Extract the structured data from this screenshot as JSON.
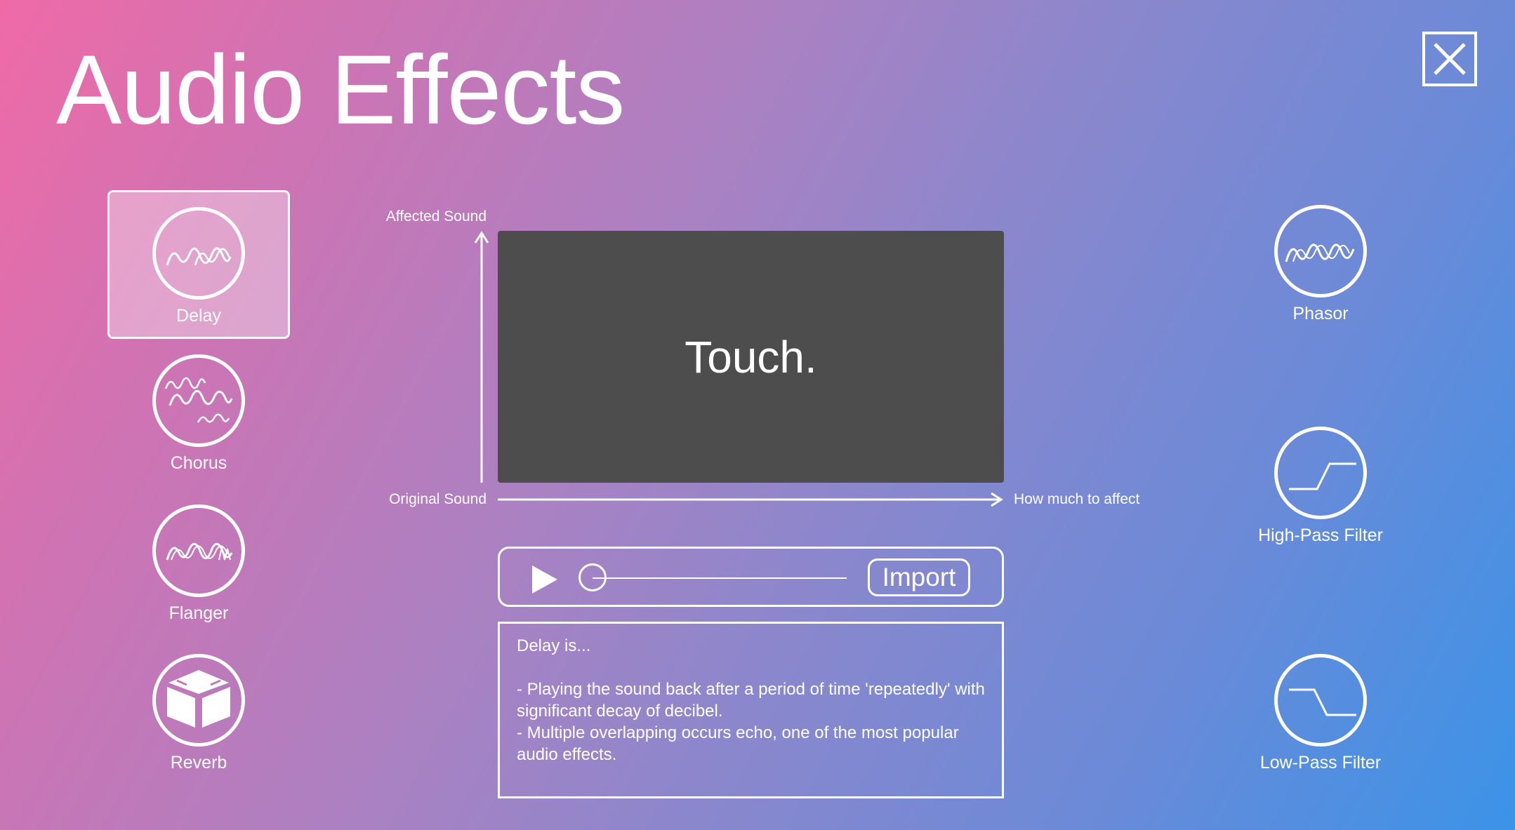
{
  "window": {
    "title": "Audio Effects"
  },
  "effects_left": [
    {
      "name": "delay",
      "label": "Delay",
      "icon": "delay-wave-icon",
      "selected": true
    },
    {
      "name": "chorus",
      "label": "Chorus",
      "icon": "chorus-wave-icon",
      "selected": false
    },
    {
      "name": "flanger",
      "label": "Flanger",
      "icon": "flanger-wave-icon",
      "selected": false
    },
    {
      "name": "reverb",
      "label": "Reverb",
      "icon": "reverb-box-icon",
      "selected": false
    }
  ],
  "effects_right": [
    {
      "name": "phasor",
      "label": "Phasor",
      "icon": "phasor-wave-icon"
    },
    {
      "name": "high-pass-filter",
      "label": "High-Pass Filter",
      "icon": "high-pass-curve-icon"
    },
    {
      "name": "low-pass-filter",
      "label": "Low-Pass Filter",
      "icon": "low-pass-curve-icon"
    }
  ],
  "pad": {
    "y_axis_label": "Affected Sound",
    "origin_label": "Original Sound",
    "x_axis_label": "How much to affect",
    "touch_text": "Touch."
  },
  "player": {
    "play_icon": "play-icon",
    "import_label": "Import",
    "progress": 0
  },
  "description": {
    "heading": "Delay is...",
    "lines": [
      "- Playing the sound back after a period of time 'repeatedly' with significant decay of decibel.",
      "- Multiple overlapping occurs echo, one of the most popular audio effects."
    ]
  },
  "colors": {
    "gradient_start": "#ef6aa7",
    "gradient_end": "#3b93e8",
    "pad_background": "#4d4d4d",
    "foreground": "#ffffff"
  }
}
